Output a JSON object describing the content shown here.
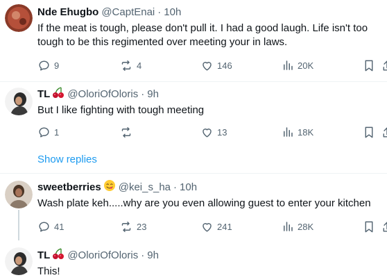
{
  "tweets": [
    {
      "name": "Nde Ehugbo",
      "handle": "@CaptEnai",
      "dot": "·",
      "time": "10h",
      "text": "If the meat is tough, please don't pull it. I had a good laugh. Life isn't too tough to be this regimented over meeting your in laws.",
      "replies": "9",
      "reposts": "4",
      "likes": "146",
      "views": "20K"
    },
    {
      "name": "TL",
      "name_emoji": "cherries-emoji",
      "handle": "@OloriOfOloris",
      "dot": "·",
      "time": "9h",
      "text": "But I like fighting with tough meeting",
      "replies": "1",
      "reposts": "",
      "likes": "13",
      "views": "18K"
    },
    {
      "name": "sweetberries",
      "name_emoji": "yum-face-emoji",
      "handle": "@kei_s_ha",
      "dot": "·",
      "time": "10h",
      "text": "Wash plate keh.....why are you even allowing guest to enter your kitchen",
      "replies": "41",
      "reposts": "23",
      "likes": "241",
      "views": "28K"
    },
    {
      "name": "TL",
      "name_emoji": "cherries-emoji",
      "handle": "@OloriOfOloris",
      "dot": "·",
      "time": "9h",
      "text": "This!"
    }
  ],
  "show_replies_label": "Show replies",
  "colors": {
    "accent": "#1d9bf0",
    "secondary_text": "#536471",
    "divider": "#eff3f4"
  },
  "icons": [
    "reply-icon",
    "repost-icon",
    "like-icon",
    "views-icon",
    "bookmark-icon",
    "share-icon"
  ]
}
